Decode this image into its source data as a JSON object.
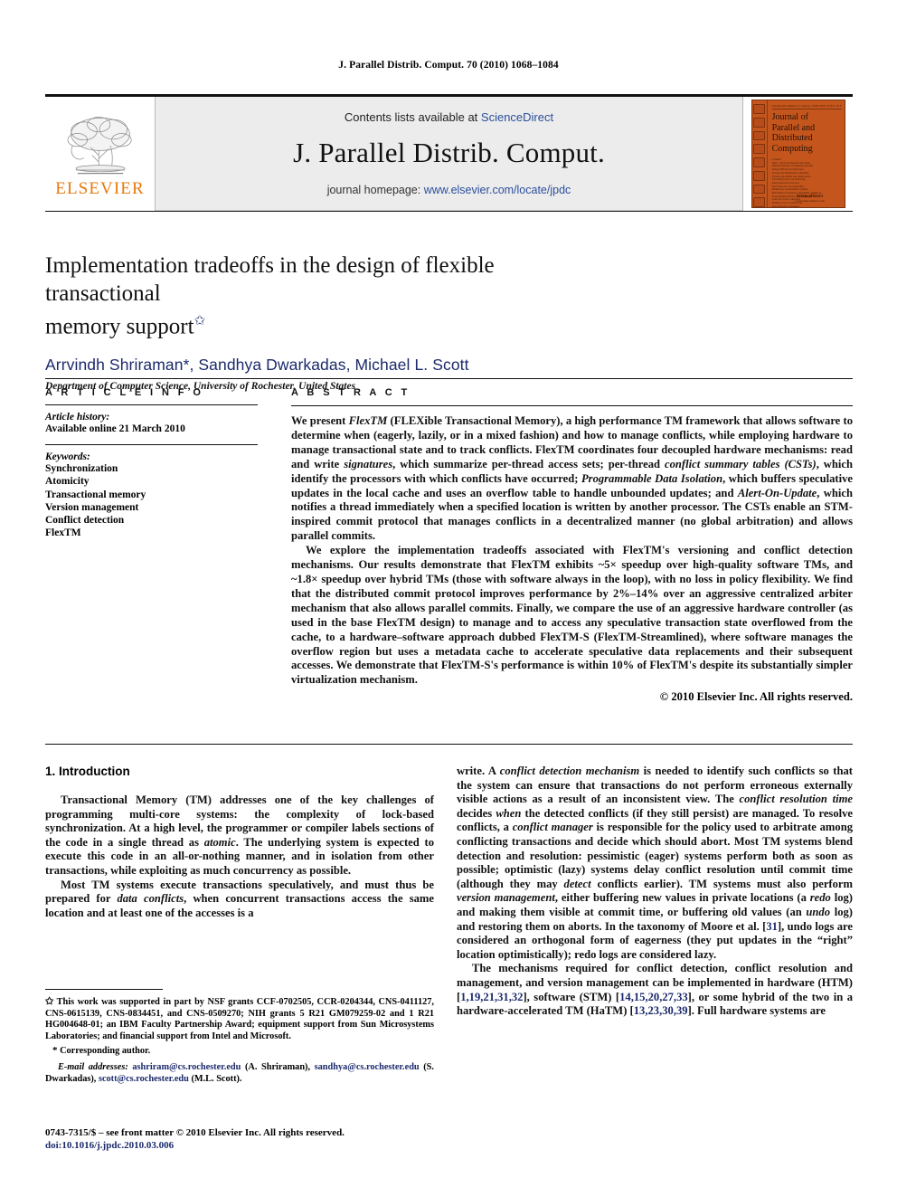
{
  "running_head": "J. Parallel Distrib. Comput. 70 (2010) 1068–1084",
  "masthead": {
    "publisher_name": "ELSEVIER",
    "contents_prefix": "Contents lists available at ",
    "contents_link": "ScienceDirect",
    "journal_title": "J. Parallel Distrib. Comput.",
    "homepage_prefix": "journal homepage: ",
    "homepage_link": "www.elsevier.com/locate/jpdc",
    "cover": {
      "top_line": "Volume 68    Number 4    January 2008    ISSN 0743-7315",
      "title_lines": [
        "Journal of",
        "Parallel and",
        "Distributed",
        "Computing"
      ],
      "contents_blurb": "Contents\nEditor: Tarek El-Ghazawi and others\nHigh Performance Computing Systems\nEnergy Efficient Architectures\nCluster and Distributed Computing\nParallel Algorithms and Applications\nScheduling and Load Balancing\nInterconnection Networks\nFault Tolerance and Reliability\nMiddleware and Runtime Systems\nPerformance Evaluation\nProgramming Models and Languages\nGrid and Cloud Computing\nMultiprocessor Architectures\nData Intensive Computing\nParallel I/O and Storage",
      "footer_label": "Available online at",
      "footer_brand": "ScienceDirect",
      "footer_url": "www.sciencedirect.com"
    }
  },
  "title": {
    "line1": "Implementation tradeoffs in the design of flexible transactional",
    "line2": "memory support",
    "footnote_marker": "✩"
  },
  "authors": "Arrvindh Shriraman*, Sandhya Dwarkadas, Michael L. Scott",
  "affiliation": "Department of Computer Science, University of Rochester, United States",
  "article_info": {
    "heading": "A R T I C L E   I N F O",
    "history_label": "Article history:",
    "history_value": "Available online 21 March 2010",
    "keywords_label": "Keywords:",
    "keywords": [
      "Synchronization",
      "Atomicity",
      "Transactional memory",
      "Version management",
      "Conflict detection",
      "FlexTM"
    ]
  },
  "abstract": {
    "heading": "A B S T R A C T",
    "paragraph1_parts": [
      {
        "t": "We present ",
        "style": "normal"
      },
      {
        "t": "FlexTM",
        "style": "italic"
      },
      {
        "t": " (FLEXible Transactional Memory), a high performance TM framework that allows software to determine when (eagerly, lazily, or in a mixed fashion) and how to manage conflicts, while employing hardware to manage transactional state and to track conflicts. FlexTM coordinates four decoupled hardware mechanisms: read and write ",
        "style": "normal"
      },
      {
        "t": "signatures",
        "style": "italic"
      },
      {
        "t": ", which summarize per-thread access sets; per-thread ",
        "style": "normal"
      },
      {
        "t": "conflict summary tables (CSTs)",
        "style": "italic"
      },
      {
        "t": ", which identify the processors with which conflicts have occurred; ",
        "style": "normal"
      },
      {
        "t": "Programmable Data Isolation",
        "style": "italic"
      },
      {
        "t": ", which buffers speculative updates in the local cache and uses an overflow table to handle unbounded updates; and ",
        "style": "normal"
      },
      {
        "t": "Alert-On-Update",
        "style": "italic"
      },
      {
        "t": ", which notifies a thread immediately when a specified location is written by another processor. The CSTs enable an STM-inspired commit protocol that manages conflicts in a decentralized manner (no global arbitration) and allows parallel commits.",
        "style": "normal"
      }
    ],
    "paragraph2_parts": [
      {
        "t": "We explore the implementation tradeoffs associated with FlexTM's versioning and conflict detection mechanisms. Our results demonstrate that FlexTM exhibits ~5× speedup over high-quality software TMs, and ~1.8× speedup over hybrid TMs (those with software always in the loop), with no loss in policy flexibility. We find that the distributed commit protocol improves performance by 2%–14% over an aggressive centralized arbiter mechanism that also allows parallel commits. Finally, we compare the use of an aggressive hardware controller (as used in the base FlexTM design) to manage and to access any speculative transaction state overflowed from the cache, to a hardware–software approach dubbed FlexTM-S (FlexTM-Streamlined), where software manages the overflow region but uses a metadata cache to accelerate speculative data replacements and their subsequent accesses. We demonstrate that FlexTM-S's performance is within 10% of FlexTM's despite its substantially simpler virtualization mechanism.",
        "style": "normal"
      }
    ],
    "copyright": "© 2010 Elsevier Inc. All rights reserved."
  },
  "body": {
    "section1_heading": "1.  Introduction",
    "left_p1_parts": [
      {
        "t": "Transactional Memory (TM) addresses one of the key challenges of programming multi-core systems: the complexity of lock-based synchronization. At a high level, the programmer or compiler labels sections of the code in a single thread as ",
        "style": "normal"
      },
      {
        "t": "atomic",
        "style": "italic"
      },
      {
        "t": ". The underlying system is expected to execute this code in an all-or-nothing manner, and in isolation from other transactions, while exploiting as much concurrency as possible.",
        "style": "normal"
      }
    ],
    "left_p2_parts": [
      {
        "t": "Most TM systems execute transactions speculatively, and must thus be prepared for ",
        "style": "normal"
      },
      {
        "t": "data conflicts",
        "style": "italic"
      },
      {
        "t": ", when concurrent transactions access the same location and at least one of the accesses is a",
        "style": "normal"
      }
    ],
    "right_p1_parts": [
      {
        "t": "write. A ",
        "style": "normal"
      },
      {
        "t": "conflict detection mechanism",
        "style": "italic"
      },
      {
        "t": " is needed to identify such conflicts so that the system can ensure that transactions do not perform erroneous externally visible actions as a result of an inconsistent view. The ",
        "style": "normal"
      },
      {
        "t": "conflict resolution time",
        "style": "italic"
      },
      {
        "t": " decides ",
        "style": "normal"
      },
      {
        "t": "when",
        "style": "italic"
      },
      {
        "t": " the detected conflicts (if they still persist) are managed. To resolve conflicts, a ",
        "style": "normal"
      },
      {
        "t": "conflict manager",
        "style": "italic"
      },
      {
        "t": " is responsible for the policy used to arbitrate among conflicting transactions and decide which should abort. Most TM systems blend detection and resolution: pessimistic (eager) systems perform both as soon as possible; optimistic (lazy) systems delay conflict resolution until commit time (although they may ",
        "style": "normal"
      },
      {
        "t": "detect",
        "style": "italic"
      },
      {
        "t": " conflicts earlier). TM systems must also perform ",
        "style": "normal"
      },
      {
        "t": "version management",
        "style": "italic"
      },
      {
        "t": ", either buffering new values in private locations (a ",
        "style": "normal"
      },
      {
        "t": "redo",
        "style": "italic"
      },
      {
        "t": " log) and making them visible at commit time, or buffering old values (an ",
        "style": "normal"
      },
      {
        "t": "undo",
        "style": "italic"
      },
      {
        "t": " log) and restoring them on aborts. In the taxonomy of Moore et al. [",
        "style": "normal"
      },
      {
        "t": "31",
        "style": "ref"
      },
      {
        "t": "], undo logs are considered an orthogonal form of eagerness (they put updates in the “right” location optimistically); redo logs are considered lazy.",
        "style": "normal"
      }
    ],
    "right_p2_parts": [
      {
        "t": "The mechanisms required for conflict detection, conflict resolution and management, and version management can be implemented in hardware (HTM) [",
        "style": "normal"
      },
      {
        "t": "1,19,21,31,32",
        "style": "ref"
      },
      {
        "t": "], software (STM) [",
        "style": "normal"
      },
      {
        "t": "14,15,20,27,33",
        "style": "ref"
      },
      {
        "t": "], or some hybrid of the two in a hardware-accelerated TM (HaTM) [",
        "style": "normal"
      },
      {
        "t": "13,23,30,39",
        "style": "ref"
      },
      {
        "t": "]. Full hardware systems are",
        "style": "normal"
      }
    ]
  },
  "footnotes": {
    "funding_marker": "✩",
    "funding_text": "This work was supported in part by NSF grants CCF-0702505, CCR-0204344, CNS-0411127, CNS-0615139, CNS-0834451, and CNS-0509270; NIH grants 5 R21 GM079259-02 and 1 R21 HG004648-01; an IBM Faculty Partnership Award; equipment support from Sun Microsystems Laboratories; and financial support from Intel and Microsoft.",
    "corresponding_marker": "*",
    "corresponding_text": "Corresponding author.",
    "email_label": "E-mail addresses:",
    "emails": [
      {
        "address": "ashriram@cs.rochester.edu",
        "name": " (A. Shriraman),"
      },
      {
        "address": "sandhya@cs.rochester.edu",
        "name": " (S. Dwarkadas),"
      },
      {
        "address": "scott@cs.rochester.edu",
        "name": " (M.L. Scott)."
      }
    ]
  },
  "imprint": {
    "issn_line": "0743-7315/$ – see front matter © 2010 Elsevier Inc. All rights reserved.",
    "doi": "doi:10.1016/j.jpdc.2010.03.006"
  },
  "colors": {
    "link": "#1B2A6B",
    "science_direct": "#2B4F9B",
    "elsevier_orange": "#E8790B",
    "cover_bg": "#C4561D"
  }
}
